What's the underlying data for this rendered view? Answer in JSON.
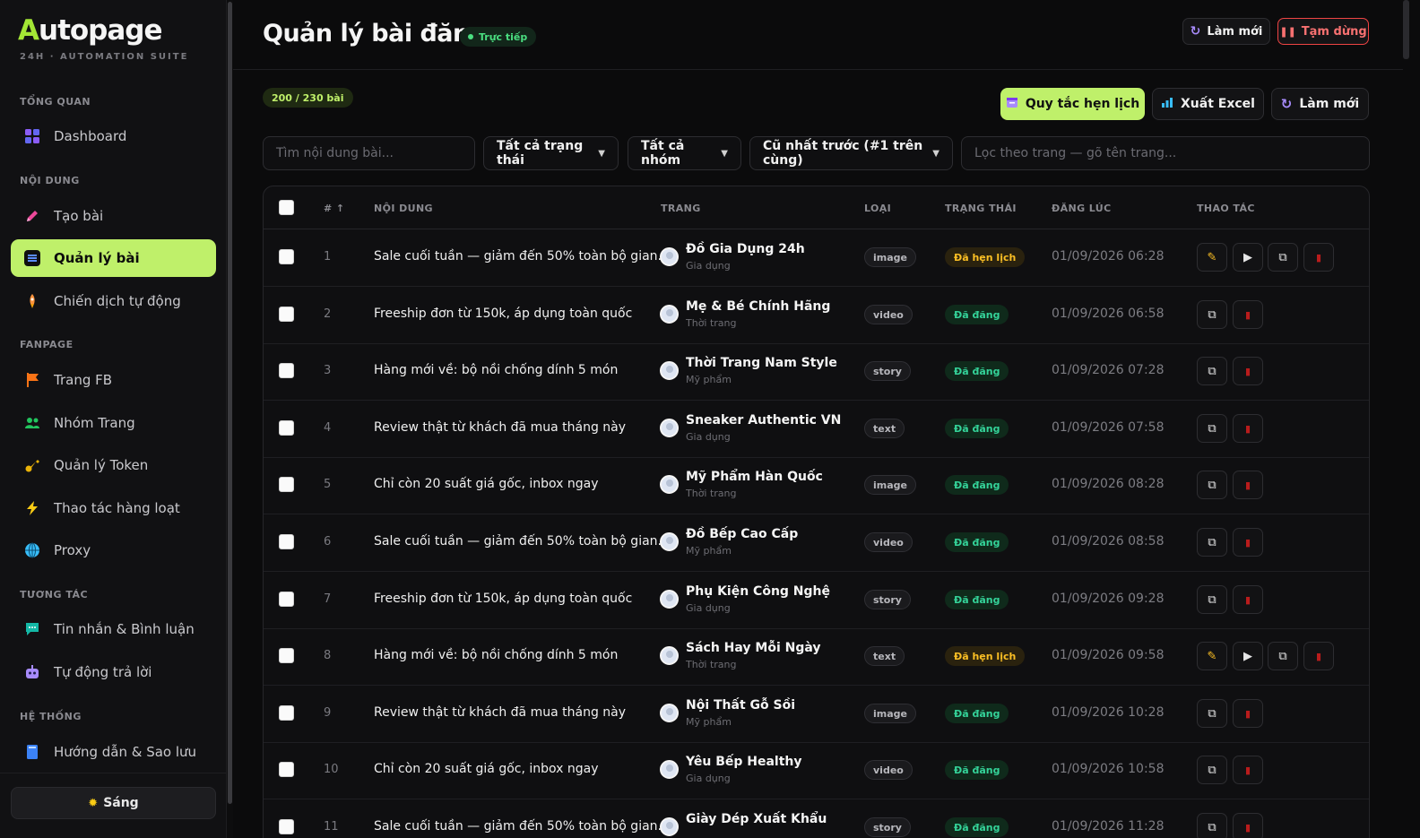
{
  "brand": {
    "logo_first": "A",
    "logo_rest": "utopage",
    "subtitle": "24H · AUTOMATION SUITE"
  },
  "sidebar": {
    "sections": {
      "overview": "TỔNG QUAN",
      "content": "NỘI DUNG",
      "fanpage": "FANPAGE",
      "interaction": "TƯƠNG TÁC",
      "system": "HỆ THỐNG"
    },
    "items": [
      {
        "label": "Dashboard",
        "icon": "grid-icon"
      },
      {
        "label": "Tạo bài",
        "icon": "pencil-icon"
      },
      {
        "label": "Quản lý bài",
        "icon": "document-icon",
        "active": true
      },
      {
        "label": "Chiến dịch tự động",
        "icon": "rocket-icon"
      },
      {
        "label": "Trang FB",
        "icon": "flag-icon"
      },
      {
        "label": "Nhóm Trang",
        "icon": "users-icon"
      },
      {
        "label": "Quản lý Token",
        "icon": "key-icon"
      },
      {
        "label": "Thao tác hàng loạt",
        "icon": "lightning-icon"
      },
      {
        "label": "Proxy",
        "icon": "globe-icon"
      },
      {
        "label": "Tin nhắn & Bình luận",
        "icon": "chat-icon"
      },
      {
        "label": "Tự động trả lời",
        "icon": "robot-icon"
      },
      {
        "label": "Hướng dẫn & Sao lưu",
        "icon": "book-icon"
      }
    ],
    "theme_toggle": "Sáng"
  },
  "header": {
    "title": "Quản lý bài đăng",
    "live_badge": "Trực tiếp",
    "refresh": "Làm mới",
    "pause": "Tạm dừng"
  },
  "toolbar": {
    "count": "200 / 230 bài",
    "schedule_rules": "Quy tắc hẹn lịch",
    "export_excel": "Xuất Excel",
    "refresh": "Làm mới"
  },
  "filters": {
    "search_placeholder": "Tìm nội dung bài...",
    "status": "Tất cả trạng thái",
    "group": "Tất cả nhóm",
    "sort": "Cũ nhất trước (#1 trên cùng)",
    "page_placeholder": "Lọc theo trang — gõ tên trang..."
  },
  "table": {
    "columns": {
      "num": "# ↑",
      "content": "NỘI DUNG",
      "page": "TRANG",
      "type": "LOẠI",
      "status": "TRẠNG THÁI",
      "posted_at": "ĐĂNG LÚC",
      "actions": "THAO TÁC"
    },
    "rows": [
      {
        "num": "1",
        "content": "Sale cuối tuần — giảm đến 50% toàn bộ gian...",
        "page": "Đồ Gia Dụng 24h",
        "category": "Gia dụng",
        "type": "image",
        "status": "Đã hẹn lịch",
        "scheduled": true,
        "date": "01/09/2026 06:28"
      },
      {
        "num": "2",
        "content": "Freeship đơn từ 150k, áp dụng toàn quốc",
        "page": "Mẹ & Bé Chính Hãng",
        "category": "Thời trang",
        "type": "video",
        "status": "Đã đăng",
        "scheduled": false,
        "date": "01/09/2026 06:58"
      },
      {
        "num": "3",
        "content": "Hàng mới về: bộ nồi chống dính 5 món",
        "page": "Thời Trang Nam Style",
        "category": "Mỹ phẩm",
        "type": "story",
        "status": "Đã đăng",
        "scheduled": false,
        "date": "01/09/2026 07:28"
      },
      {
        "num": "4",
        "content": "Review thật từ khách đã mua tháng này",
        "page": "Sneaker Authentic VN",
        "category": "Gia dụng",
        "type": "text",
        "status": "Đã đăng",
        "scheduled": false,
        "date": "01/09/2026 07:58"
      },
      {
        "num": "5",
        "content": "Chỉ còn 20 suất giá gốc, inbox ngay",
        "page": "Mỹ Phẩm Hàn Quốc",
        "category": "Thời trang",
        "type": "image",
        "status": "Đã đăng",
        "scheduled": false,
        "date": "01/09/2026 08:28"
      },
      {
        "num": "6",
        "content": "Sale cuối tuần — giảm đến 50% toàn bộ gian...",
        "page": "Đồ Bếp Cao Cấp",
        "category": "Mỹ phẩm",
        "type": "video",
        "status": "Đã đăng",
        "scheduled": false,
        "date": "01/09/2026 08:58"
      },
      {
        "num": "7",
        "content": "Freeship đơn từ 150k, áp dụng toàn quốc",
        "page": "Phụ Kiện Công Nghệ",
        "category": "Gia dụng",
        "type": "story",
        "status": "Đã đăng",
        "scheduled": false,
        "date": "01/09/2026 09:28"
      },
      {
        "num": "8",
        "content": "Hàng mới về: bộ nồi chống dính 5 món",
        "page": "Sách Hay Mỗi Ngày",
        "category": "Thời trang",
        "type": "text",
        "status": "Đã hẹn lịch",
        "scheduled": true,
        "date": "01/09/2026 09:58"
      },
      {
        "num": "9",
        "content": "Review thật từ khách đã mua tháng này",
        "page": "Nội Thất Gỗ Sồi",
        "category": "Mỹ phẩm",
        "type": "image",
        "status": "Đã đăng",
        "scheduled": false,
        "date": "01/09/2026 10:28"
      },
      {
        "num": "10",
        "content": "Chỉ còn 20 suất giá gốc, inbox ngay",
        "page": "Yêu Bếp Healthy",
        "category": "Gia dụng",
        "type": "video",
        "status": "Đã đăng",
        "scheduled": false,
        "date": "01/09/2026 10:58"
      },
      {
        "num": "11",
        "content": "Sale cuối tuần — giảm đến 50% toàn bộ gian...",
        "page": "Giày Dép Xuất Khẩu",
        "category": "",
        "type": "story",
        "status": "Đã đăng",
        "scheduled": false,
        "date": "01/09/2026 11:28"
      }
    ]
  },
  "colors": {
    "accent": "#bff06a",
    "scheduled": "#fbbf24",
    "posted": "#34d399",
    "danger": "#ef4444"
  }
}
